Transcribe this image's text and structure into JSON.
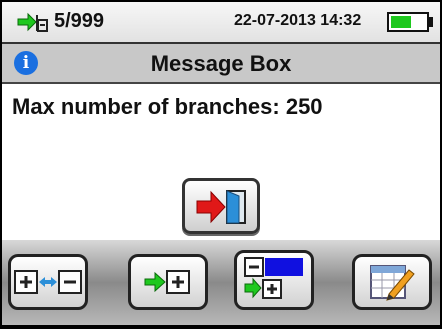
{
  "status_bar": {
    "counter": "5/999",
    "datetime": "22-07-2013 14:32",
    "battery_level": 0.6,
    "icons": [
      "memory-save-icon",
      "battery-icon"
    ]
  },
  "dialog": {
    "title": "Message Box",
    "message": "Max number of branches: 250",
    "icons": [
      "info-icon",
      "exit-door-icon"
    ]
  },
  "toolbar": {
    "buttons": [
      {
        "name": "add-remove-branch-button",
        "icon": "plus-minus-icon"
      },
      {
        "name": "add-branch-button",
        "icon": "arrow-plus-icon"
      },
      {
        "name": "insert-branch-button",
        "icon": "list-insert-icon"
      },
      {
        "name": "edit-button",
        "icon": "edit-table-icon"
      }
    ]
  },
  "colors": {
    "accent_green": "#1ec81e",
    "info_blue": "#1a6fe0",
    "arrow_red": "#e01818",
    "door_blue": "#2c8fd8"
  }
}
